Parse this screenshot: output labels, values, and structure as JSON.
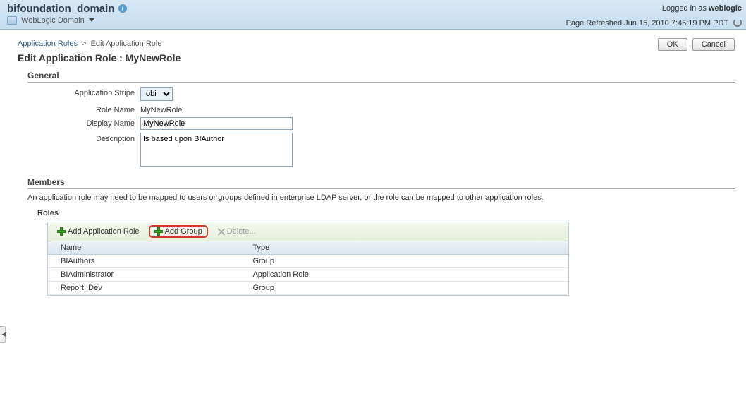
{
  "header": {
    "domain_title": "bifoundation_domain",
    "sub_domain_label": "WebLogic Domain",
    "logged_in_prefix": "Logged in as",
    "logged_in_user": "weblogic",
    "refresh_prefix": "Page Refreshed",
    "refresh_time": "Jun 15, 2010 7:45:19 PM PDT"
  },
  "breadcrumb": {
    "parent": "Application Roles",
    "current": "Edit Application Role"
  },
  "page_title": "Edit Application Role : MyNewRole",
  "actions": {
    "ok": "OK",
    "cancel": "Cancel"
  },
  "general": {
    "section_label": "General",
    "stripe_label": "Application Stripe",
    "stripe_value": "obi",
    "role_name_label": "Role Name",
    "role_name_value": "MyNewRole",
    "display_name_label": "Display Name",
    "display_name_value": "MyNewRole",
    "description_label": "Description",
    "description_value": "Is based upon BIAuthor"
  },
  "members": {
    "section_label": "Members",
    "description": "An application role may need to be mapped to users or groups defined in enterprise LDAP server, or the role can be mapped to other application roles.",
    "roles_label": "Roles",
    "toolbar": {
      "add_app_role": "Add Application Role",
      "add_group": "Add Group",
      "delete": "Delete..."
    },
    "columns": {
      "name": "Name",
      "type": "Type"
    },
    "rows": [
      {
        "name": "BIAuthors",
        "type": "Group"
      },
      {
        "name": "BIAdministrator",
        "type": "Application Role"
      },
      {
        "name": "Report_Dev",
        "type": "Group"
      }
    ]
  }
}
